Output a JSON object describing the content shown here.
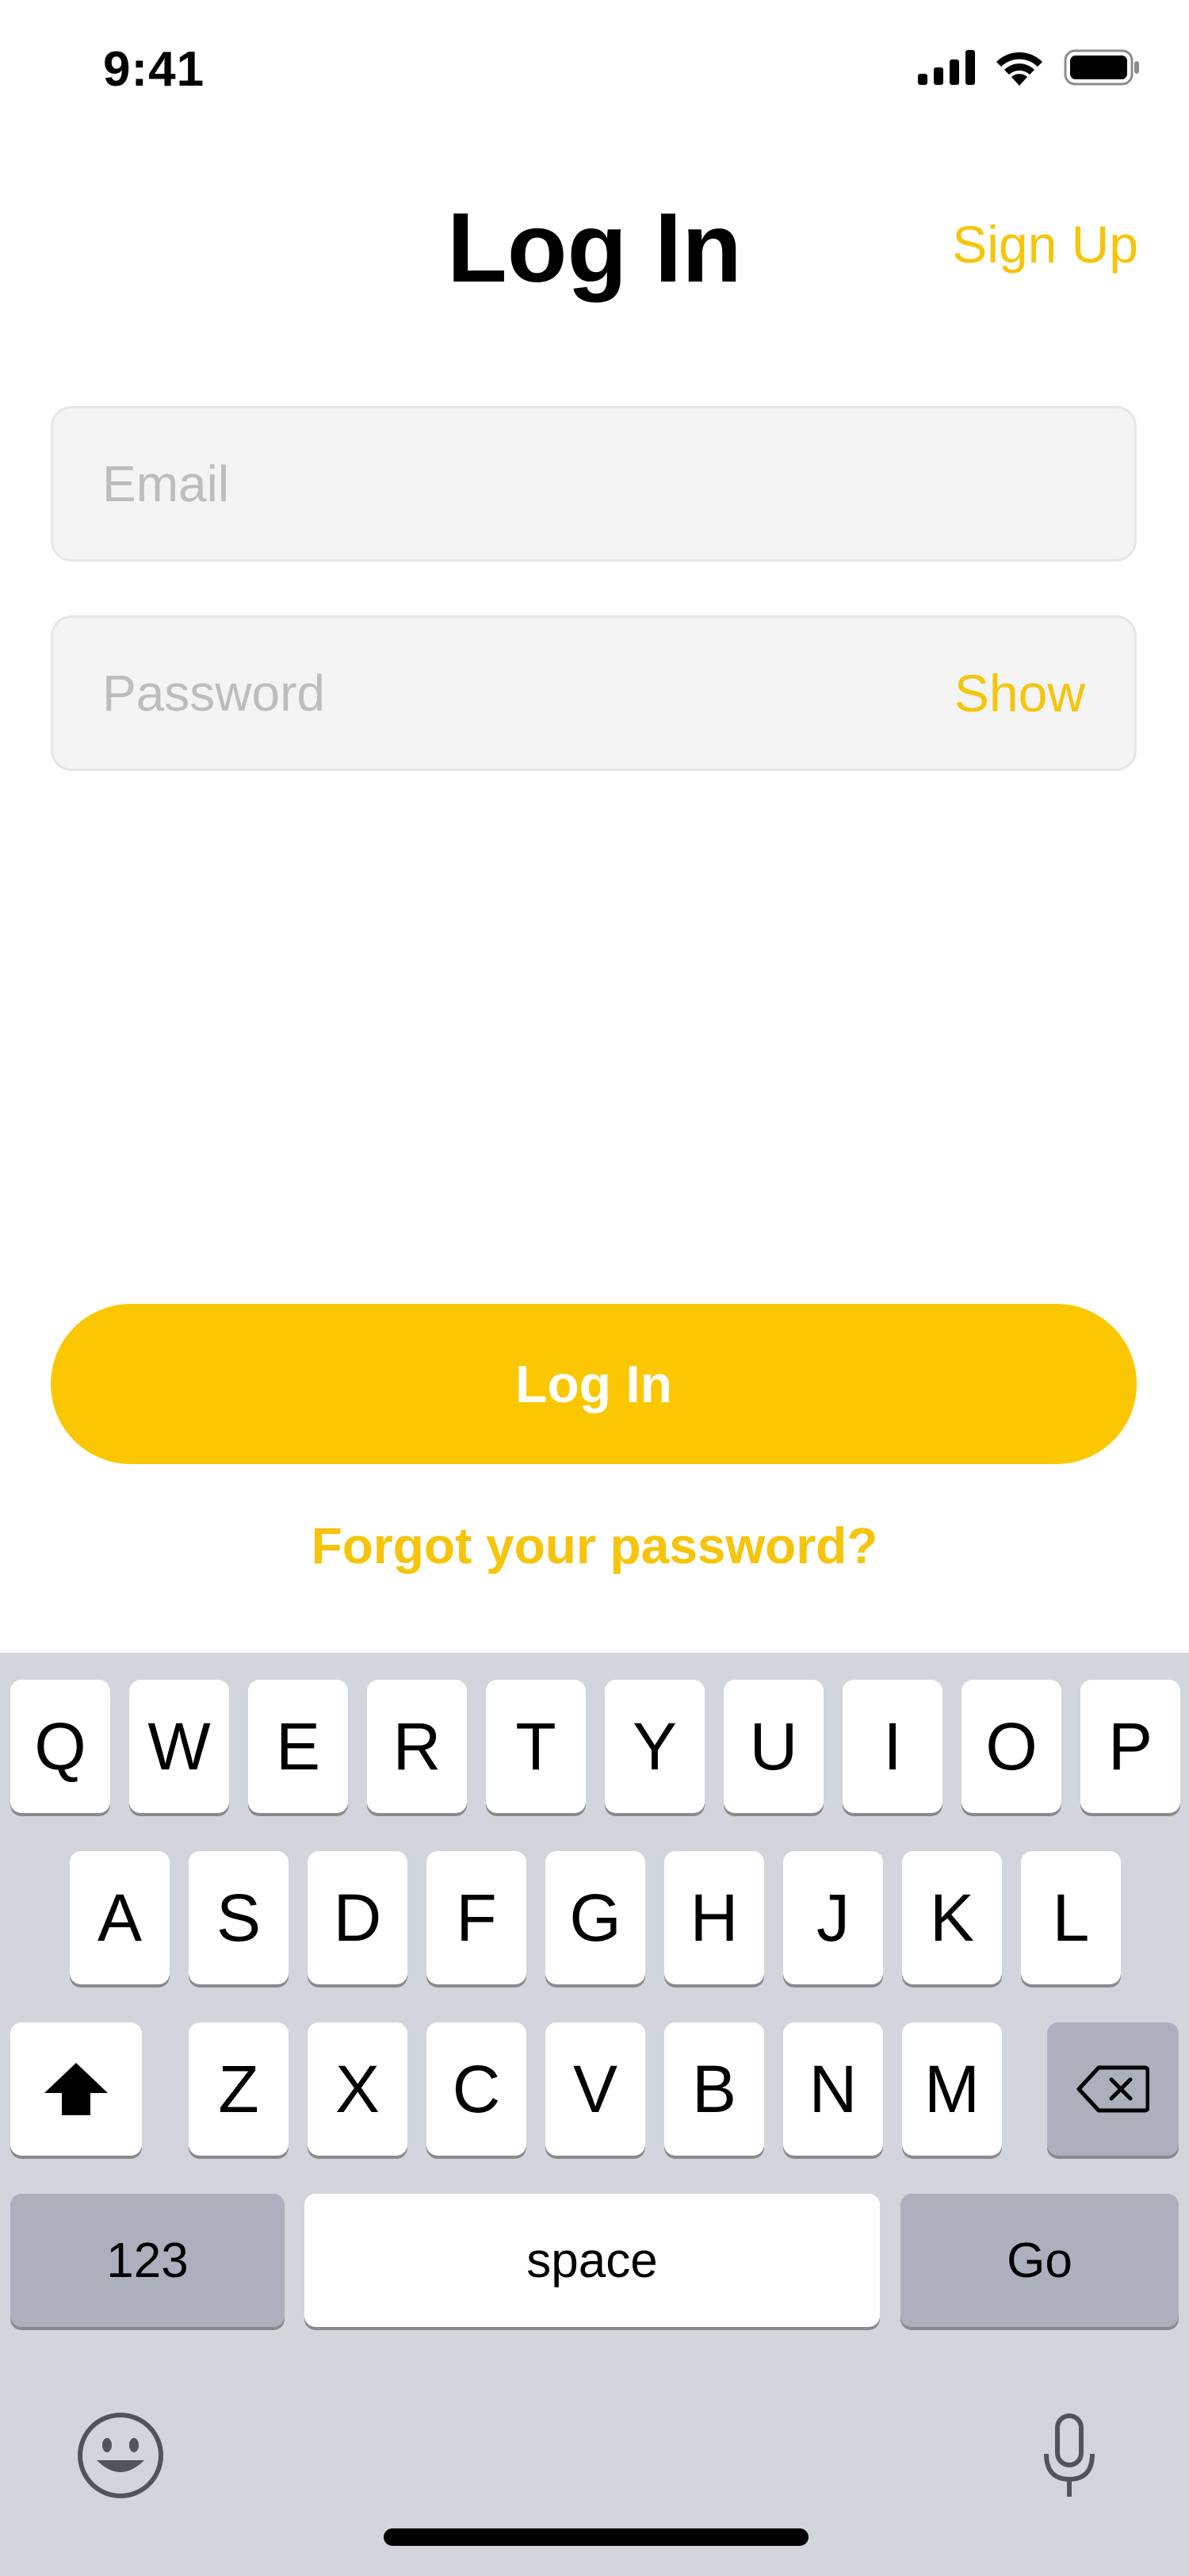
{
  "status_bar": {
    "time": "9:41"
  },
  "header": {
    "title": "Log In",
    "signup_label": "Sign Up"
  },
  "form": {
    "email": {
      "value": "",
      "placeholder": "Email"
    },
    "password": {
      "value": "",
      "placeholder": "Password",
      "show_label": "Show"
    },
    "login_label": "Log In",
    "forgot_label": "Forgot your password?"
  },
  "colors": {
    "accent": "#fbc700",
    "link": "#f6c40a",
    "keyboard_bg": "#d2d5db"
  },
  "keyboard": {
    "row1": [
      "Q",
      "W",
      "E",
      "R",
      "T",
      "Y",
      "U",
      "I",
      "O",
      "P"
    ],
    "row2": [
      "A",
      "S",
      "D",
      "F",
      "G",
      "H",
      "J",
      "K",
      "L"
    ],
    "row3": [
      "Z",
      "X",
      "C",
      "V",
      "B",
      "N",
      "M"
    ],
    "shift_icon": "shift-arrow-icon",
    "delete_icon": "backspace-icon",
    "numbers_label": "123",
    "space_label": "space",
    "go_label": "Go",
    "emoji_icon": "emoji-face-icon",
    "mic_icon": "microphone-icon"
  }
}
